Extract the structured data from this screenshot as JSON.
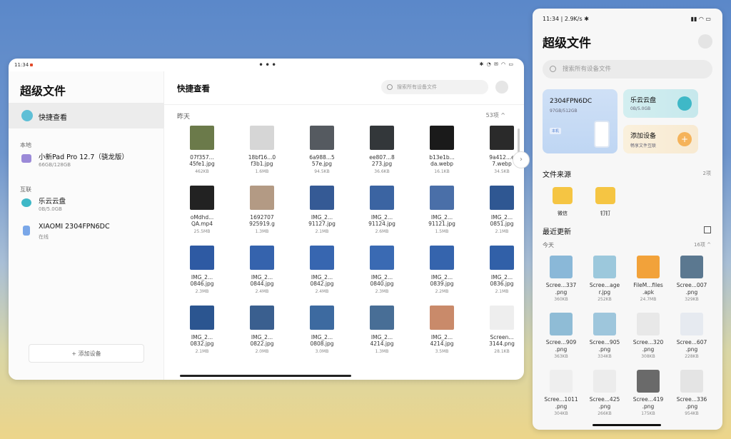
{
  "tablet": {
    "status": {
      "time": "11:34",
      "right_icons": "✱ ◔ ✉ ◠ ▭"
    },
    "sidebar": {
      "title": "超级文件",
      "quick_view": "快捷查看",
      "section_local": "本地",
      "local_device_name": "小新Pad Pro 12.7（骁龙版）",
      "local_device_storage": "66GB/128GB",
      "section_interconnect": "互联",
      "cloud_name": "乐云云盘",
      "cloud_storage": "0B/5.0GB",
      "phone_name": "XIAOMI 2304FPN6DC",
      "phone_status": "在线",
      "add_device": "添加设备"
    },
    "main": {
      "title": "快捷查看",
      "search_placeholder": "搜索所有设备文件",
      "section_label": "昨天",
      "count": "53项 ^",
      "files": [
        {
          "n1": "07f357...",
          "n2": "45fe1.jpg",
          "size": "462KB",
          "color": "#6b7a4a"
        },
        {
          "n1": "18bf16...0",
          "n2": "f3b1.jpg",
          "size": "1.6MB",
          "color": "#d6d6d6"
        },
        {
          "n1": "6a988...5",
          "n2": "57e.jpg",
          "size": "94.5KB",
          "color": "#555a60"
        },
        {
          "n1": "ee807...8",
          "n2": "273.jpg",
          "size": "36.6KB",
          "color": "#33373a"
        },
        {
          "n1": "b13e1b...",
          "n2": "da.webp",
          "size": "16.1KB",
          "color": "#1a1a1a"
        },
        {
          "n1": "9a412...e",
          "n2": "7.webp",
          "size": "34.5KB",
          "color": "#2a2a2a"
        },
        {
          "n1": "oMdhd...",
          "n2": "QA.mp4",
          "size": "25.5MB",
          "color": "#222"
        },
        {
          "n1": "1692707",
          "n2": "925919.g",
          "size": "1.3MB",
          "color": "#b39a84"
        },
        {
          "n1": "IMG_2...",
          "n2": "91127.jpg",
          "size": "2.1MB",
          "color": "#355a95"
        },
        {
          "n1": "IMG_2...",
          "n2": "91124.jpg",
          "size": "2.6MB",
          "color": "#3b64a2"
        },
        {
          "n1": "IMG_2...",
          "n2": "91121.jpg",
          "size": "1.5MB",
          "color": "#4a6fa8"
        },
        {
          "n1": "IMG_2...",
          "n2": "0851.jpg",
          "size": "2.1MB",
          "color": "#2f5792"
        },
        {
          "n1": "IMG_2...",
          "n2": "0846.jpg",
          "size": "2.3MB",
          "color": "#2e5aa3"
        },
        {
          "n1": "IMG_2...",
          "n2": "0844.jpg",
          "size": "2.4MB",
          "color": "#3563ad"
        },
        {
          "n1": "IMG_2...",
          "n2": "0842.jpg",
          "size": "2.4MB",
          "color": "#3766b0"
        },
        {
          "n1": "IMG_2...",
          "n2": "0840.jpg",
          "size": "2.3MB",
          "color": "#3a6ab3"
        },
        {
          "n1": "IMG_2...",
          "n2": "0839.jpg",
          "size": "2.2MB",
          "color": "#3564ad"
        },
        {
          "n1": "IMG_2...",
          "n2": "0836.jpg",
          "size": "2.1MB",
          "color": "#3160a8"
        },
        {
          "n1": "IMG_2...",
          "n2": "0832.jpg",
          "size": "2.1MB",
          "color": "#2b5590"
        },
        {
          "n1": "IMG_2...",
          "n2": "0822.jpg",
          "size": "2.0MB",
          "color": "#3a5f8f"
        },
        {
          "n1": "IMG_2...",
          "n2": "0808.jpg",
          "size": "3.0MB",
          "color": "#3d6aa0"
        },
        {
          "n1": "IMG_2...",
          "n2": "4214.jpg",
          "size": "1.3MB",
          "color": "#486e96"
        },
        {
          "n1": "IMG_2...",
          "n2": "4214.jpg",
          "size": "3.5MB",
          "color": "#c98a6a"
        },
        {
          "n1": "Screen...",
          "n2": "3144.png",
          "size": "28.1KB",
          "color": "#eeeeee"
        }
      ]
    }
  },
  "phone": {
    "status": {
      "left": "11:34 | 2.9K/s ✱",
      "right": "▮▮ ◠ ▭"
    },
    "title": "超级文件",
    "search_placeholder": "搜索所有设备文件",
    "device_card": {
      "name": "2304FPN6DC",
      "storage": "97GB/512GB",
      "tag": "本机"
    },
    "cloud_card": {
      "name": "乐云云盘",
      "storage": "0B/5.0GB"
    },
    "add_card": {
      "name": "添加设备",
      "sub": "畅享文件互联",
      "plus": "+"
    },
    "sources_label": "文件来源",
    "sources_count": "2项",
    "sources": [
      {
        "label": "微信"
      },
      {
        "label": "钉钉"
      }
    ],
    "recent_label": "最近更新",
    "today_label": "今天",
    "today_count": "16项 ^",
    "files": [
      {
        "n1": "Scree...337",
        "n2": ".png",
        "size": "360KB",
        "color": "#8ab8d8"
      },
      {
        "n1": "Scree...age",
        "n2": "r.jpg",
        "size": "252KB",
        "color": "#9cc8dc"
      },
      {
        "n1": "FileM...files",
        "n2": ".apk",
        "size": "24.7MB",
        "color": "#f2a23a"
      },
      {
        "n1": "Scree...007",
        "n2": ".png",
        "size": "329KB",
        "color": "#5b7890"
      },
      {
        "n1": "Scree...909",
        "n2": ".png",
        "size": "363KB",
        "color": "#8fbcd6"
      },
      {
        "n1": "Scree...905",
        "n2": ".png",
        "size": "334KB",
        "color": "#9ec6dc"
      },
      {
        "n1": "Scree...320",
        "n2": ".png",
        "size": "308KB",
        "color": "#e8e8e8"
      },
      {
        "n1": "Scree...607",
        "n2": ".png",
        "size": "228KB",
        "color": "#e6eaf0"
      },
      {
        "n1": "Scree...1011",
        "n2": ".png",
        "size": "304KB",
        "color": "#eeeeee"
      },
      {
        "n1": "Scree...425",
        "n2": ".png",
        "size": "266KB",
        "color": "#ececec"
      },
      {
        "n1": "Scree...419",
        "n2": ".png",
        "size": "175KB",
        "color": "#6a6a6a"
      },
      {
        "n1": "Scree...336",
        "n2": ".png",
        "size": "954KB",
        "color": "#e4e4e4"
      }
    ]
  }
}
